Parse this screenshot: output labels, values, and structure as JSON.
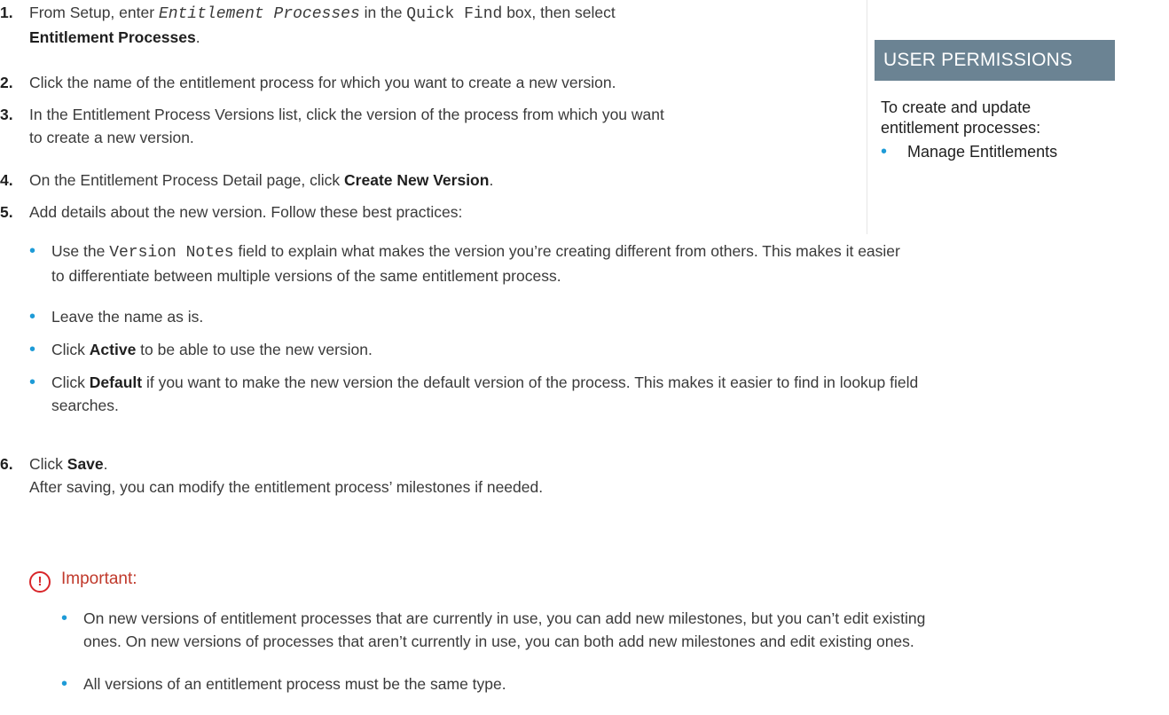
{
  "steps": [
    {
      "num": "1.",
      "a": "From Setup, enter ",
      "code1": "Entitlement Processes",
      "b": " in the ",
      "code2": "Quick Find",
      "c": " box, then select",
      "bold": "Entitlement Processes",
      "d": "."
    },
    {
      "num": "2.",
      "text": "Click the name of the entitlement process for which you want to create a new version."
    },
    {
      "num": "3.",
      "line1": "In the Entitlement Process Versions list, click the version of the process from which you want",
      "line2": "to create a new version."
    },
    {
      "num": "4.",
      "a": "On the Entitlement Process Detail page, click ",
      "bold": "Create New Version",
      "b": "."
    },
    {
      "num": "5.",
      "text": "Add details about the new version. Follow these best practices:"
    },
    {
      "num": "6.",
      "a": "Click ",
      "bold": "Save",
      "b": ".",
      "note": "After saving, you can modify the entitlement process’ milestones if needed."
    }
  ],
  "practices": [
    {
      "a": "Use the ",
      "code": "Version Notes",
      "b": " field to explain what makes the version you’re creating different from others. This makes it easier",
      "line2": "to differentiate between multiple versions of the same entitlement process."
    },
    {
      "text": "Leave the name as is."
    },
    {
      "a": "Click ",
      "bold": "Active",
      "b": " to be able to use the new version."
    },
    {
      "a": "Click ",
      "bold": "Default",
      "b": " if you want to make the new version the default version of the process. This makes it easier to find in lookup field",
      "line2": "searches."
    }
  ],
  "sidebar": {
    "title": "USER PERMISSIONS",
    "desc_line1": "To create and update",
    "desc_line2": "entitlement processes:",
    "item": "Manage Entitlements"
  },
  "important": {
    "icon": "!",
    "label": "Important:",
    "items": [
      {
        "line1": "On new versions of entitlement processes that are currently in use, you can add new milestones, but you can’t edit existing",
        "line2": "ones. On new versions of processes that aren’t currently in use, you can both add new milestones and edit existing ones."
      },
      {
        "line1": "All versions of an entitlement process must be the same type."
      }
    ]
  },
  "bullet_glyph": "•",
  "colors": {
    "bullet": "#1e9bd7",
    "header_bg": "#6b8393",
    "important": "#d9262a"
  }
}
